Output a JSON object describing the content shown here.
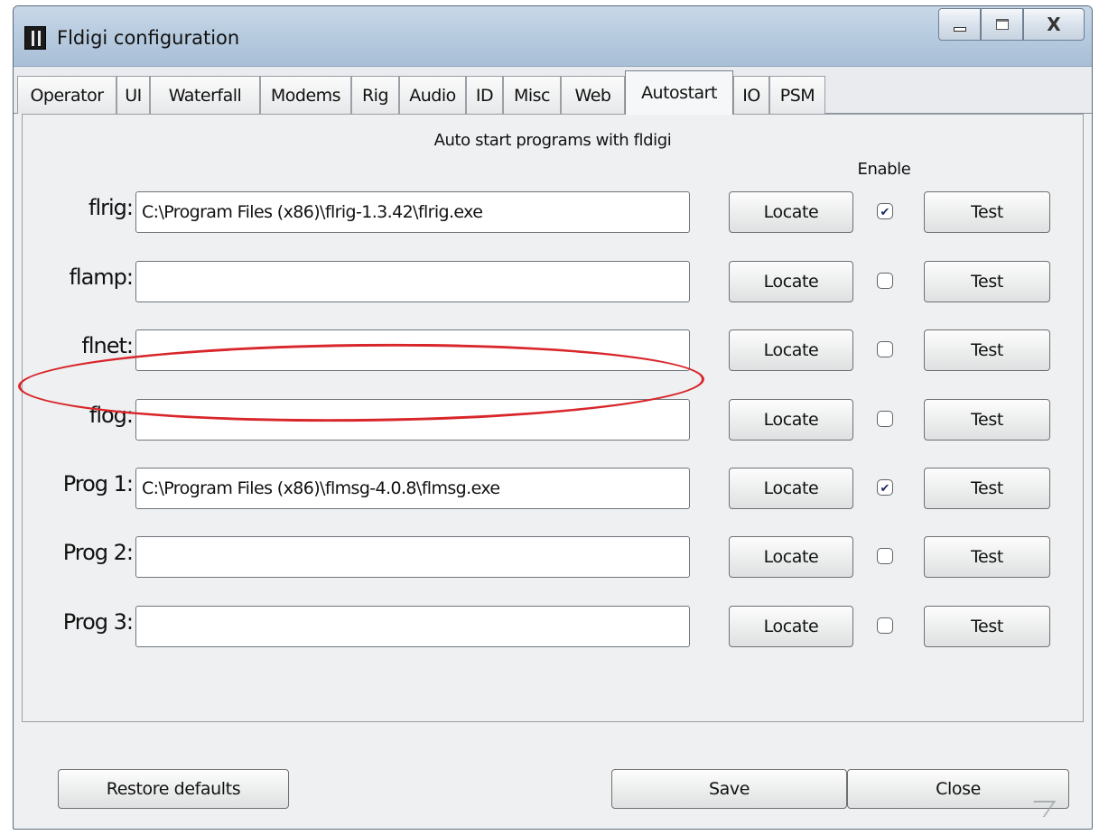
{
  "window": {
    "title": "Fldigi configuration",
    "close_glyph": "X"
  },
  "tabs": [
    {
      "label": "Operator"
    },
    {
      "label": "UI"
    },
    {
      "label": "Waterfall"
    },
    {
      "label": "Modems"
    },
    {
      "label": "Rig"
    },
    {
      "label": "Audio"
    },
    {
      "label": "ID"
    },
    {
      "label": "Misc"
    },
    {
      "label": "Web"
    },
    {
      "label": "Autostart",
      "active": true
    },
    {
      "label": "IO"
    },
    {
      "label": "PSM"
    }
  ],
  "panel": {
    "heading": "Auto start programs with fldigi",
    "enable_heading": "Enable",
    "locate_label": "Locate",
    "test_label": "Test",
    "rows": [
      {
        "label": "flrig:",
        "path": "C:\\Program Files (x86)\\flrig-1.3.42\\flrig.exe",
        "enabled": true
      },
      {
        "label": "flamp:",
        "path": "",
        "enabled": false
      },
      {
        "label": "flnet:",
        "path": "",
        "enabled": false
      },
      {
        "label": "flog:",
        "path": "",
        "enabled": false
      },
      {
        "label": "Prog 1:",
        "path": "C:\\Program Files (x86)\\flmsg-4.0.8\\flmsg.exe",
        "enabled": true
      },
      {
        "label": "Prog 2:",
        "path": "",
        "enabled": false
      },
      {
        "label": "Prog 3:",
        "path": "",
        "enabled": false
      }
    ]
  },
  "footer": {
    "restore_label": "Restore defaults",
    "save_label": "Save",
    "close_label": "Close"
  },
  "colors": {
    "highlight": "#d8262a",
    "checkmark": "#1d2a66"
  },
  "icons": {
    "app": "fldigi-app-icon",
    "minimize": "minimize-icon",
    "maximize": "maximize-icon",
    "close": "close-icon",
    "checked": "checkmark-icon",
    "grip": "resize-grip-icon"
  }
}
